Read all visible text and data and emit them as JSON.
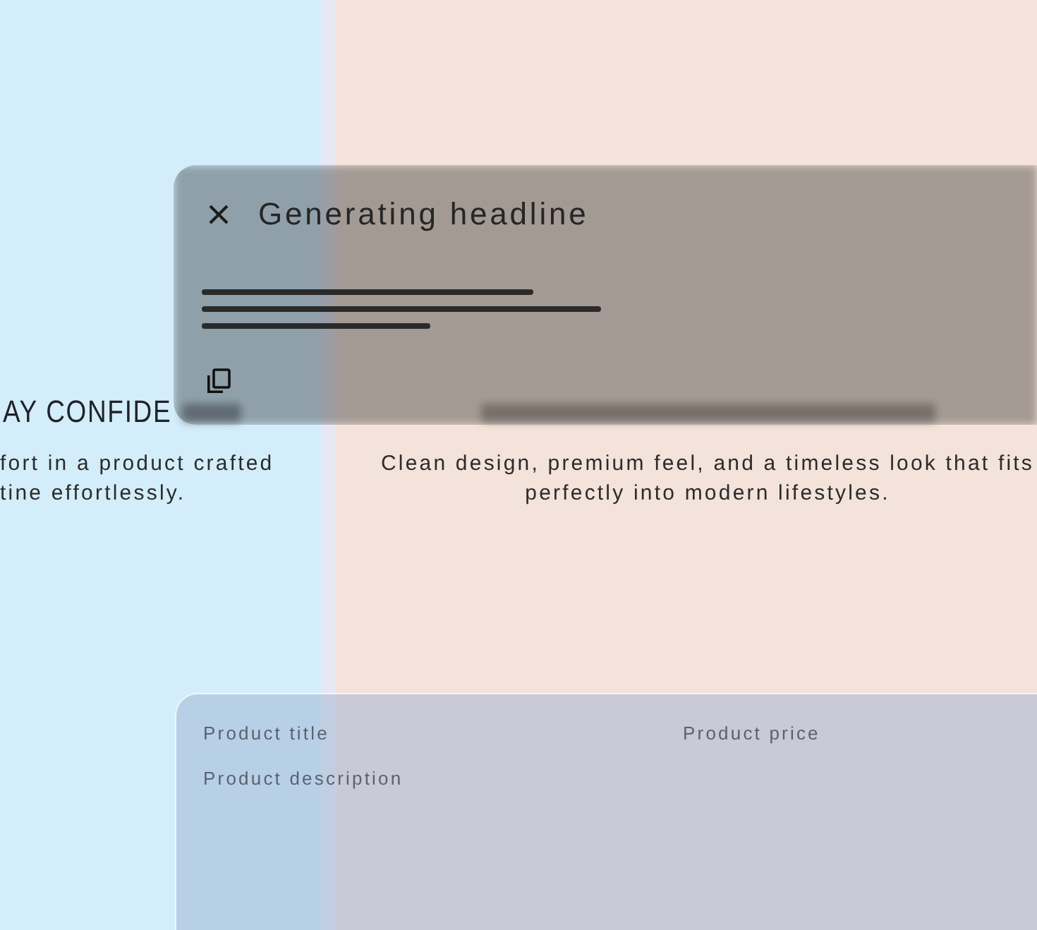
{
  "left_panel": {
    "heading": "AY CONFIDE",
    "description": [
      "fort in a product crafted",
      "tine effortlessly."
    ]
  },
  "right_panel": {
    "description": [
      "Clean design, premium feel, and a timeless look that fits",
      "perfectly into modern lifestyles."
    ]
  },
  "dialog": {
    "title": "Generating headline"
  },
  "form": {
    "fields": [
      {
        "label": "Product title"
      },
      {
        "label": "Product price"
      },
      {
        "label": "Product description"
      }
    ]
  }
}
